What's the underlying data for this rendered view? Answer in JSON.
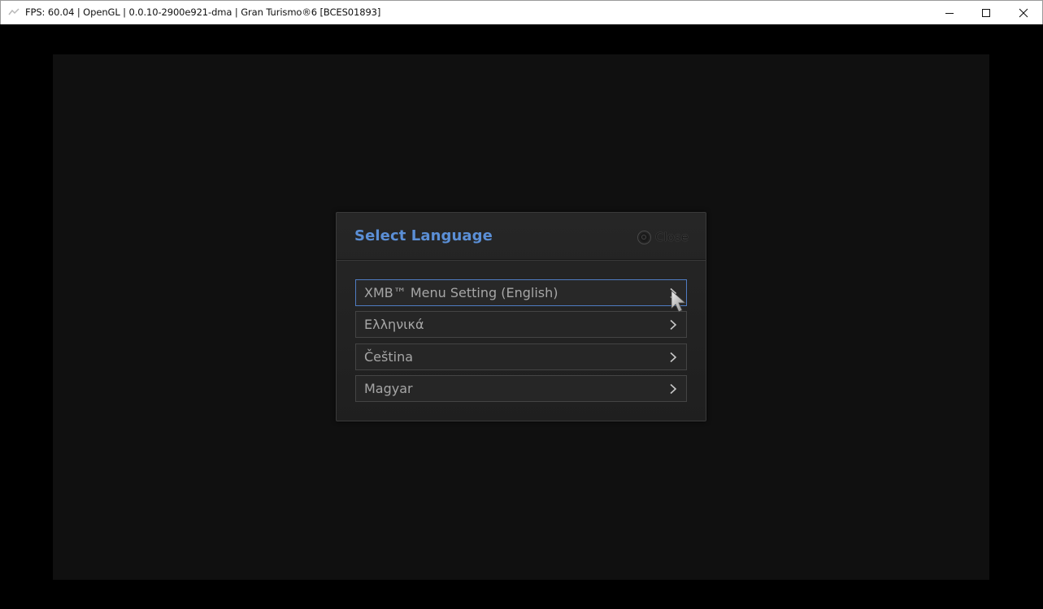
{
  "window": {
    "title": "FPS: 60.04 | OpenGL | 0.0.10-2900e921-dma | Gran Turismo®6 [BCES01893]",
    "icon": "rpcs3-app-icon",
    "controls": [
      "minimize-icon",
      "maximize-icon",
      "close-icon"
    ]
  },
  "dialog": {
    "title": "Select Language",
    "close_label": "Close",
    "close_icon": "circle-button-icon",
    "accent_color": "#5b8fd6",
    "items": [
      {
        "label": "XMB™ Menu Setting (English)",
        "selected": true
      },
      {
        "label": "Ελληνικά",
        "selected": false
      },
      {
        "label": "Čeština",
        "selected": false
      },
      {
        "label": "Magyar",
        "selected": false
      }
    ]
  }
}
